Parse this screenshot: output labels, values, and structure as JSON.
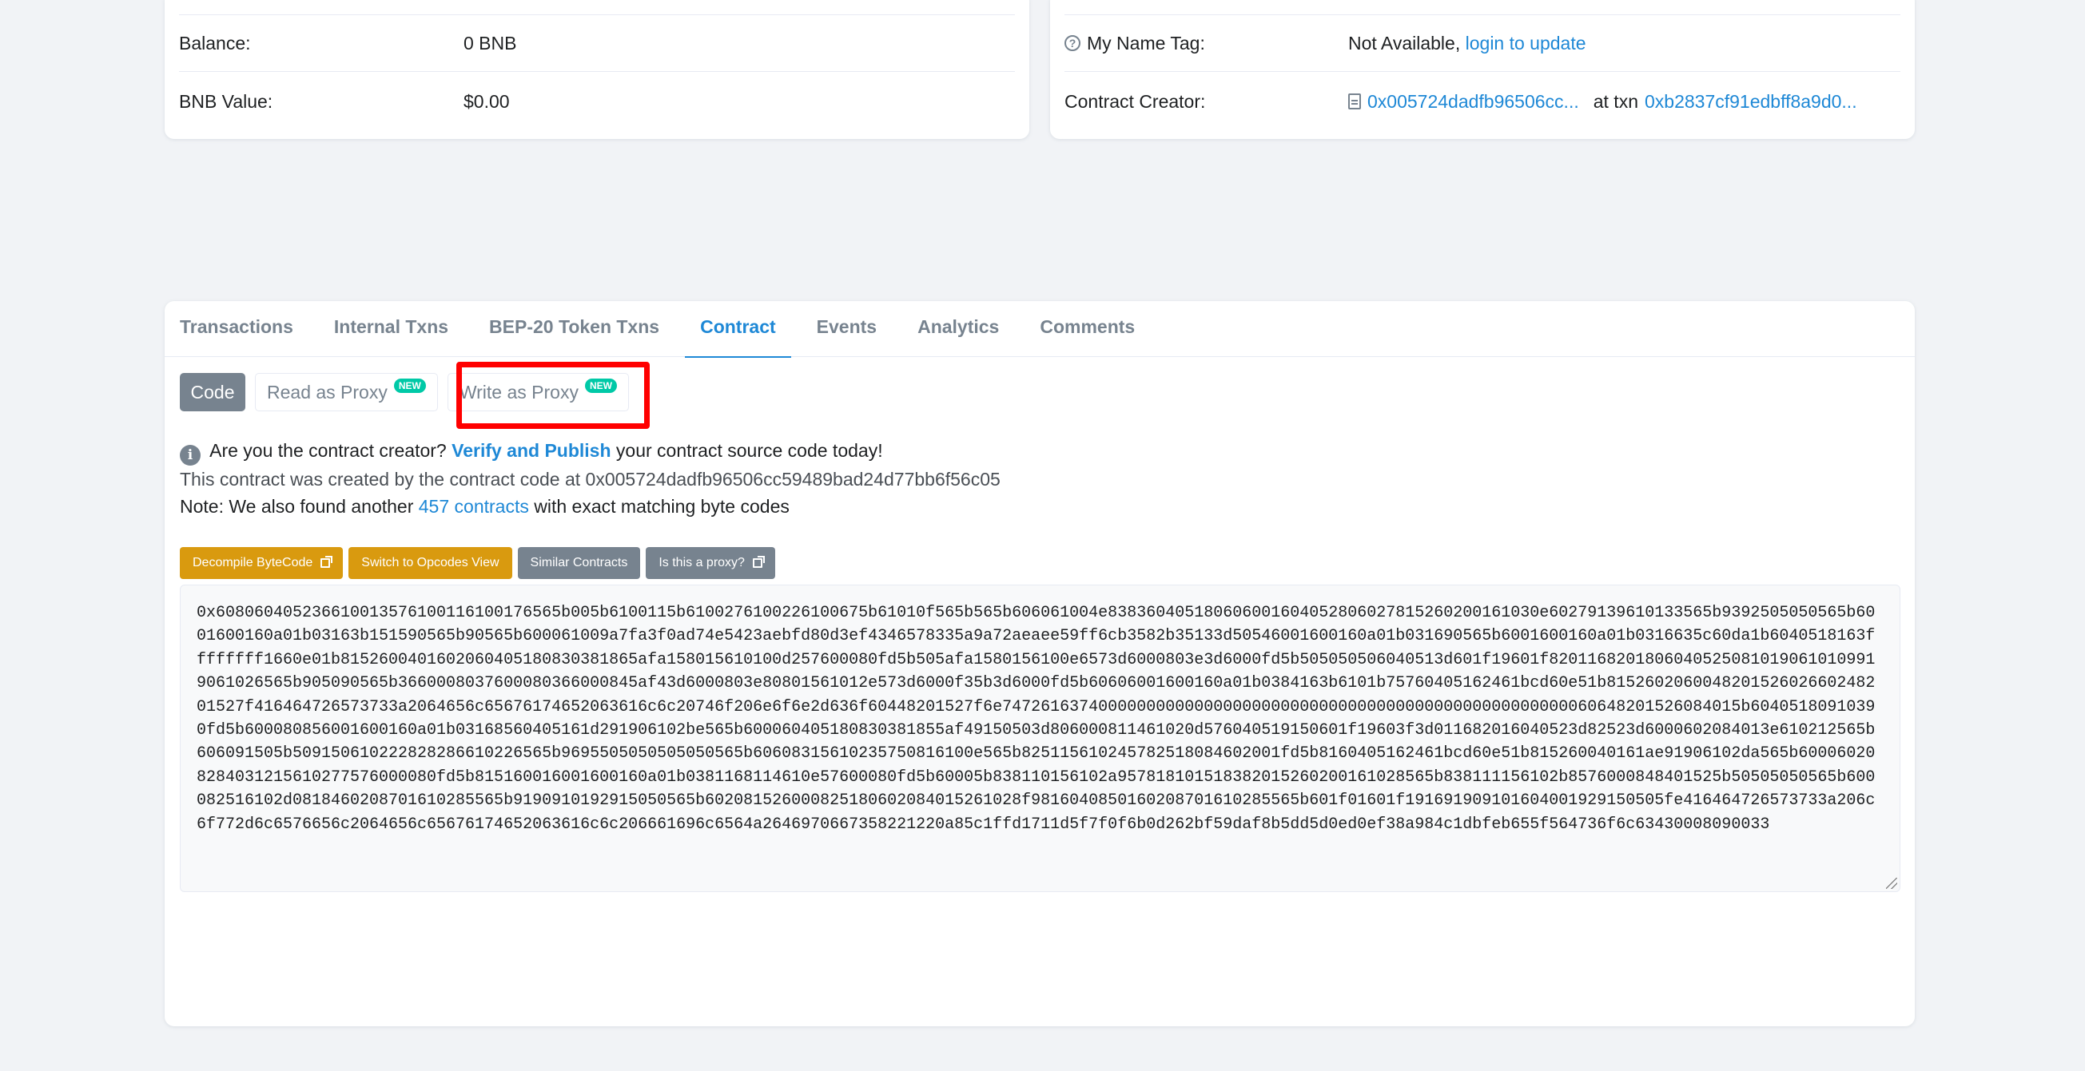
{
  "overview": {
    "balance_label": "Balance:",
    "balance_value": "0 BNB",
    "bnb_value_label": "BNB Value:",
    "bnb_value_value": "$0.00"
  },
  "more_info": {
    "name_tag_label": "My Name Tag:",
    "name_tag_value": "Not Available,",
    "name_tag_link": "login to update",
    "creator_label": "Contract Creator:",
    "creator_address": "0x005724dadfb96506cc...",
    "at_txn_text": "at txn",
    "creator_txn": "0xb2837cf91edbff8a9d0..."
  },
  "tabs": [
    {
      "label": "Transactions"
    },
    {
      "label": "Internal Txns"
    },
    {
      "label": "BEP-20 Token Txns"
    },
    {
      "label": "Contract"
    },
    {
      "label": "Events"
    },
    {
      "label": "Analytics"
    },
    {
      "label": "Comments"
    }
  ],
  "subtabs": {
    "code_label": "Code",
    "read_proxy_label": "Read as Proxy",
    "write_proxy_label": "Write as Proxy",
    "new_badge": "NEW"
  },
  "notice": {
    "question": "Are you the contract creator?",
    "verify_link": "Verify and Publish",
    "question_tail": "your contract source code today!",
    "created_by_text": "This contract was created by the contract code at",
    "created_by_address": "0x005724dadfb96506cc59489bad24d77bb6f56c05",
    "note_prefix": "Note: We also found another",
    "note_link": "457 contracts",
    "note_suffix": "with exact matching byte codes"
  },
  "actions": {
    "decompile": "Decompile ByteCode",
    "opcodes": "Switch to Opcodes View",
    "similar": "Similar Contracts",
    "is_proxy": "Is this a proxy?"
  },
  "bytecode": "0x608060405236610013576100116100176565b005b6100115b6100276100226100675b61010f565b565b606061004e838360405180606001604052806027815260200161030e60279139610133565b9392505050565b6001600160a01b03163b151590565b90565b600061009a7fa3f0ad74e5423aebfd80d3ef4346578335a9a72aeaee59ff6cb3582b35133d50546001600160a01b031690565b6001600160a01b0316635c60da1b6040518163ffffffff1660e01b8152600401602060405180830381865afa158015610100d257600080fd5b505afa1580156100e6573d6000803e3d6000fd5b505050506040513d601f19601f82011682018060405250810190610109919061026565b905090565b3660008037600080366000845af43d6000803e80801561012e573d6000f35b3d6000fd5b60606001600160a01b0384163b6101b75760405162461bcd60e51b815260206004820152602660248201527f416464726573733a2064656c65676174652063616c6c20746f206e6f6e2d636f60448201527f6e74726163740000000000000000000000000000000000000000000000000060648201526084015b60405180910390fd5b600080856001600160a01b03168560405161d291906102be565b600060405180830381855af49150503d806000811461020d576040519150601f19603f3d011682016040523d82523d6000602084013e610212565b606091505b509150610222828286610226565b9695505050505050565b60608315610235750816100e565b825115610245782518084602001fd5b8160405162461bcd60e51b815260040161ae91906102da565b600060208284031215610277576000080fd5b815160016001600160a01b0381168114610e57600080fd5b60005b838110156102a957818101518382015260200161028565b838111156102b8576000848401525b50505050565b600082516102d0818460208701610285565b9190910192915050565b602081526000825180602084015261028f9816040850160208701610285565b601f01601f191691909101604001929150505fe416464726573733a206c6f772d6c6576656c2064656c65676174652063616c6c206661696c6564a2646970667358221220a85c1ffd1711d5f7f0f6b0d262bf59daf8b5dd5d0ed0ef38a984c1dbfeb655f564736f6c63430008090033"
}
